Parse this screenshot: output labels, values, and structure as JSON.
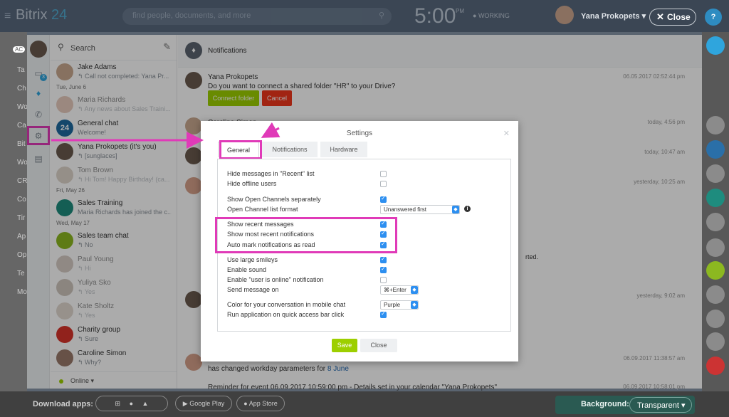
{
  "topbar": {
    "logo_main": "Bitrix",
    "logo_num": "24",
    "search_placeholder": "find people, documents, and more",
    "time": "5:00",
    "time_suffix": "PM",
    "work_status": "WORKING",
    "user_name": "Yana Prokopets",
    "close_label": "Close",
    "help_label": "?"
  },
  "rail": {
    "badge": "3"
  },
  "recent": {
    "search_label": "Search",
    "online_label": "Online",
    "items": [
      {
        "name": "Jake Adams",
        "last": "↰ Call not completed: Yana Pr..."
      },
      {
        "date": "Tue, June 6"
      },
      {
        "name": "Maria Richards",
        "last": "↰ Any news about Sales Traini..."
      },
      {
        "name": "General chat",
        "last": "Welcome!",
        "avatar_text": "24"
      },
      {
        "name": "Yana Prokopets (it's you)",
        "last": "↰ [sunglaces]"
      },
      {
        "name": "Tom Brown",
        "last": "↰ Hi Tom! Happy Birthday! (ca..."
      },
      {
        "date": "Fri, May 26"
      },
      {
        "name": "Sales Training",
        "last": "Maria Richards has joined the c..."
      },
      {
        "date": "Wed, May 17"
      },
      {
        "name": "Sales team chat",
        "last": "↰ No"
      },
      {
        "name": "Paul Young",
        "last": "↰ Hi"
      },
      {
        "name": "Yuliya Sko",
        "last": "↰ Yes"
      },
      {
        "name": "Kate Sholtz",
        "last": "↰ Yes"
      },
      {
        "name": "Charity group",
        "last": "↰ Sure"
      },
      {
        "name": "Caroline Simon",
        "last": "↰ Why?"
      }
    ]
  },
  "notifications": {
    "title": "Notifications",
    "first": {
      "author": "Yana Prokopets",
      "text": "Do you want to connect a shared folder \"HR\" to your Drive?",
      "time": "06.05.2017 02:52:44 pm",
      "connect_label": "Connect folder",
      "cancel_label": "Cancel"
    },
    "caroline_author": "Caroline Simon",
    "times": [
      "today, 4:56 pm",
      "today, 10:47 am",
      "yesterday, 10:25 am",
      "yesterday, 9:02 am",
      "06.09.2017 11:38:57 am",
      "06.09.2017 10:58:01 pm"
    ],
    "fragment_rted": "rted.",
    "workday_text": "has changed workday parameters for",
    "workday_date": "8 June",
    "reminder_text": "Reminder for event 06.09.2017 10:59:00 pm - Details set in your calendar \"Yana Prokopets\""
  },
  "settings": {
    "title": "Settings",
    "tabs": [
      "General",
      "Notifications",
      "Hardware"
    ],
    "options": [
      {
        "label": "Hide messages in \"Recent\" list",
        "type": "checkbox",
        "checked": false
      },
      {
        "label": "Hide offline users",
        "type": "checkbox",
        "checked": false
      },
      {
        "label": "Show Open Channels separately",
        "type": "checkbox",
        "checked": true
      },
      {
        "label": "Open Channel list format",
        "type": "select",
        "value": "Unanswered first"
      },
      {
        "label": "Show recent messages",
        "type": "checkbox",
        "checked": true
      },
      {
        "label": "Show most recent notifications",
        "type": "checkbox",
        "checked": true
      },
      {
        "label": "Auto mark notifications as read",
        "type": "checkbox",
        "checked": true
      },
      {
        "label": "Use large smileys",
        "type": "checkbox",
        "checked": true
      },
      {
        "label": "Enable sound",
        "type": "checkbox",
        "checked": true
      },
      {
        "label": "Enable \"user is online\" notification",
        "type": "checkbox",
        "checked": false
      },
      {
        "label": "Send message on",
        "type": "select",
        "value": "⌘+Enter"
      },
      {
        "label": "Color for your conversation in mobile chat",
        "type": "select",
        "value": "Purple"
      },
      {
        "label": "Run application on quick access bar click",
        "type": "checkbox",
        "checked": true
      }
    ],
    "save_label": "Save",
    "close_label": "Close"
  },
  "footer": {
    "download_label": "Download apps:",
    "google_play": "Google Play",
    "app_store": "App Store",
    "background_label": "Background:",
    "background_value": "Transparent"
  },
  "colors": {
    "highlight": "#e03ab8",
    "accent_green": "#9dcf00",
    "checkbox_blue": "#2d8ff0",
    "cancel_red": "#f1361b"
  }
}
